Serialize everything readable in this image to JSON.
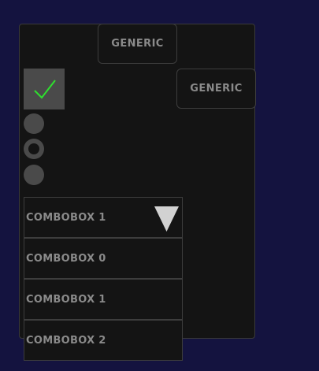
{
  "buttons": {
    "generic_1": "GENERIC",
    "generic_2": "GENERIC"
  },
  "checkbox": {
    "checked": true
  },
  "radios": [
    {
      "selected": false
    },
    {
      "selected": true
    },
    {
      "selected": false
    }
  ],
  "combobox": {
    "selected_label": "COMBOBOX 1",
    "options": [
      "COMBOBOX 0",
      "COMBOBOX 1",
      "COMBOBOX 2"
    ]
  },
  "colors": {
    "background": "#14133f",
    "panel": "#141414",
    "check": "#2ee02e",
    "text": "#8a8a8a"
  },
  "icons": {
    "check": "checkmark-icon",
    "dropdown": "triangle-down-icon"
  }
}
